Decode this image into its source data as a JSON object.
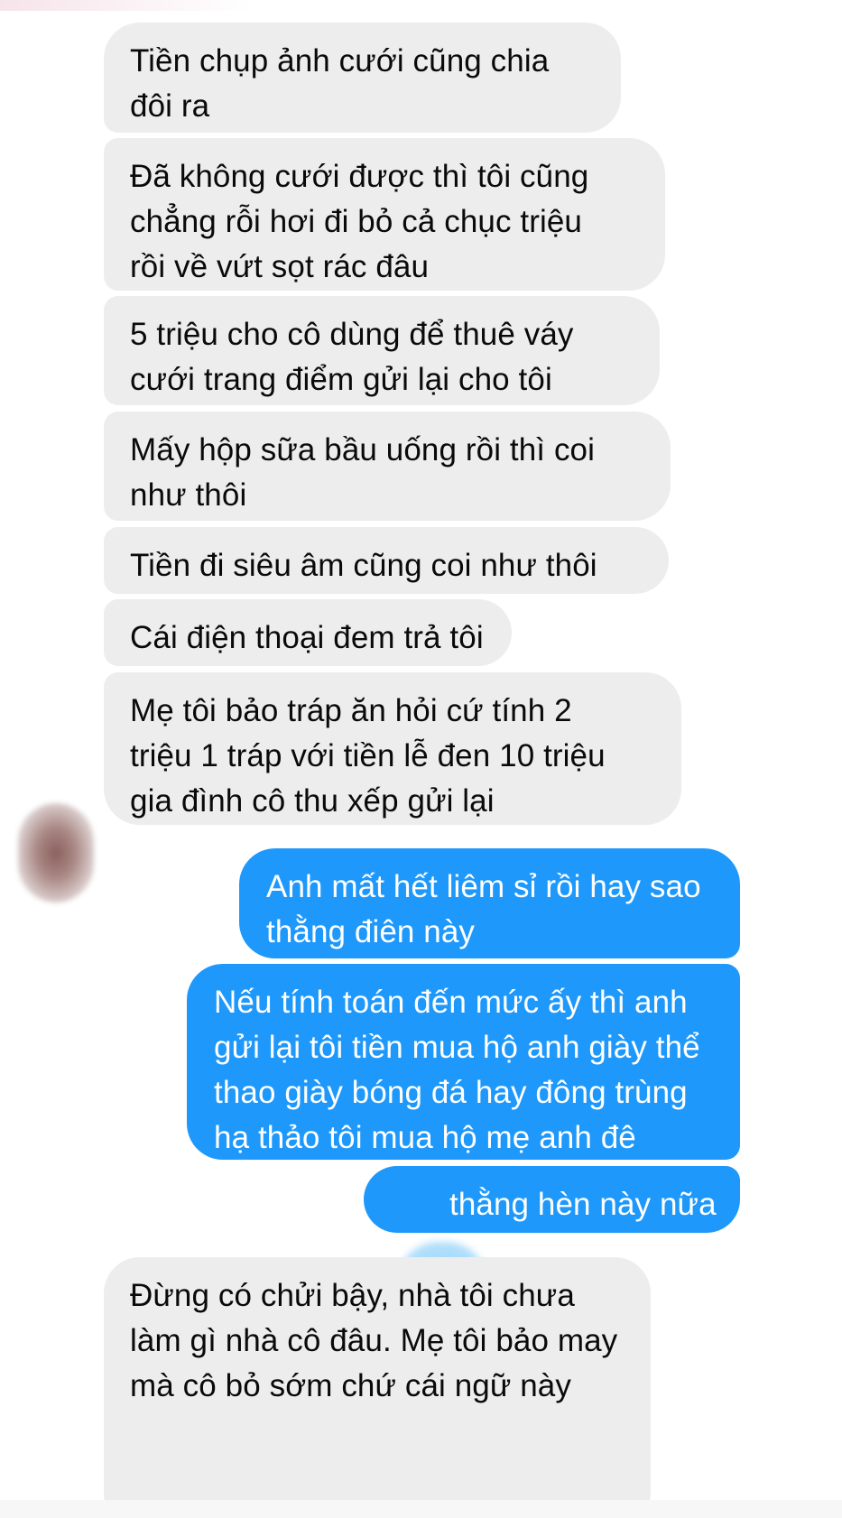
{
  "messages": [
    {
      "side": "received",
      "text": "Tiền chụp ảnh cưới cũng chia\nđôi ra"
    },
    {
      "side": "received",
      "text": "Đã không cưới được thì tôi cũng\nchẳng rỗi hơi đi bỏ cả chục triệu\nrồi về vứt sọt rác đâu"
    },
    {
      "side": "received",
      "text": "5 triệu cho cô dùng để thuê váy\ncưới trang điểm gửi lại cho tôi"
    },
    {
      "side": "received",
      "text": "Mấy hộp sữa bầu uống rồi thì coi\nnhư thôi"
    },
    {
      "side": "received",
      "text": "Tiền đi siêu âm cũng coi như thôi"
    },
    {
      "side": "received",
      "text": "Cái điện thoại đem trả tôi"
    },
    {
      "side": "received",
      "text": "Mẹ tôi bảo tráp ăn hỏi cứ tính 2\ntriệu 1 tráp với tiền lễ đen 10 triệu\ngia đình cô thu xếp gửi lại"
    },
    {
      "side": "sent",
      "text": "Anh mất hết liêm sỉ rồi hay sao\nthằng điên này"
    },
    {
      "side": "sent",
      "text": "Nếu tính toán đến mức ấy thì anh\ngửi lại tôi tiền mua hộ anh giày thể\nthao giày bóng đá hay đông trùng\nhạ thảo tôi mua hộ mẹ anh đê"
    },
    {
      "side": "sent",
      "text": "thằng hèn này nữa"
    },
    {
      "side": "received",
      "text": "Đừng có chửi bậy, nhà tôi chưa\nlàm gì nhà cô đâu. Mẹ tôi bảo may\nmà cô bỏ sớm chứ cái ngữ này"
    }
  ],
  "colors": {
    "received_bubble": "#ededed",
    "sent_bubble": "#1e98fb",
    "received_text": "#0a0a0a",
    "sent_text": "#ffffff"
  }
}
